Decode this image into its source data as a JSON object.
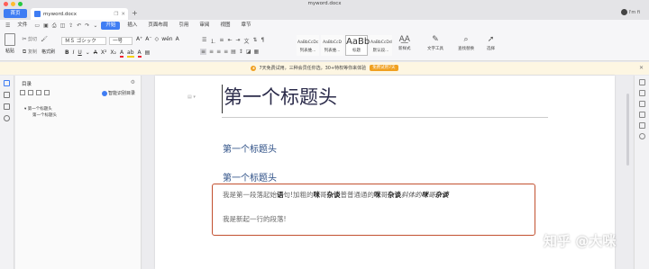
{
  "window": {
    "title": "myword.docx"
  },
  "tabs": {
    "home": "首页",
    "doc": "myword.docx",
    "new_tab": "+"
  },
  "user": {
    "name": "I'm fi"
  },
  "menu": {
    "file": "文件",
    "items": [
      "开始",
      "插入",
      "页面布局",
      "引用",
      "审阅",
      "视图",
      "章节"
    ],
    "active": "开始"
  },
  "ribbon": {
    "paste": "粘贴",
    "cut": "剪切",
    "copy": "复制",
    "format_painter": "格式刷",
    "font_name": "ＭＳ ゴシック",
    "font_size": "一号",
    "styles": [
      {
        "preview": "AaBbCcDc",
        "label": "列表维..."
      },
      {
        "preview": "AaBbCcD",
        "label": "列表维..."
      },
      {
        "preview": "AaBb",
        "label": "标题",
        "selected": true
      },
      {
        "preview": "AaBbCcDd",
        "label": "默认段..."
      }
    ],
    "new_style": "新样式",
    "text_tools": "文字工具",
    "find_replace": "查找替换",
    "select": "选择"
  },
  "notice": {
    "text": "7天免费试用，三种会员任你选，30+特权等你来体验",
    "button": "免费试用7天"
  },
  "toc": {
    "title": "目录",
    "smart_button": "智能识别目录",
    "items": [
      {
        "label": "第一个标题头",
        "level": 1
      },
      {
        "label": "第一个标题头",
        "level": 2
      }
    ]
  },
  "document": {
    "heading1": "第一个标题头",
    "heading2a": "第一个标题头",
    "heading2b": "第一个标题头",
    "para1": {
      "seg1": "我是第一段落起始",
      "seg2": "语",
      "seg3": "句",
      "seg4": "!加粗的",
      "seg5": "咪",
      "seg6": "哥",
      "seg7": "杂谈",
      "seg8": "普普通通的",
      "seg9": "咪",
      "seg10": "哥",
      "seg11": "杂谈",
      "seg12": "斜体的",
      "seg13": "咪",
      "seg14": "哥",
      "seg15": "杂谈"
    },
    "para2": "我是新起一行的段落!"
  },
  "watermark": "知乎 @大咪",
  "colors": {
    "accent": "#3f7df3",
    "heading2": "#2d4f86",
    "highlight_border": "#c2502f",
    "notice_bg": "#fdf6e2",
    "notice_btn": "#f0a020"
  }
}
